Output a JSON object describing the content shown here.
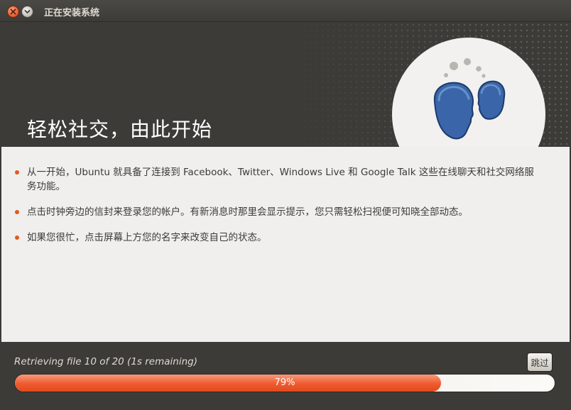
{
  "window": {
    "title": "正在安装系统"
  },
  "banner": {
    "title": "轻松社交，由此开始",
    "illustration": "social-heads-illustration"
  },
  "content": {
    "bullets": [
      "从一开始，Ubuntu 就具备了连接到 Facebook、Twitter、Windows Live 和 Google Talk 这些在线聊天和社交网络服务功能。",
      "点击时钟旁边的信封来登录您的帐户。有新消息时那里会显示提示，您只需轻松扫视便可知晓全部动态。",
      "如果您很忙，点击屏幕上方您的名字来改变自己的状态。"
    ]
  },
  "footer": {
    "status": "Retrieving file 10 of 20 (1s remaining)",
    "skip_label": "跳过",
    "progress_percent": 79,
    "progress_label": "79%"
  },
  "colors": {
    "accent": "#e05a1e",
    "dark_bg": "#3c3b37",
    "content_bg": "#f0efed"
  }
}
